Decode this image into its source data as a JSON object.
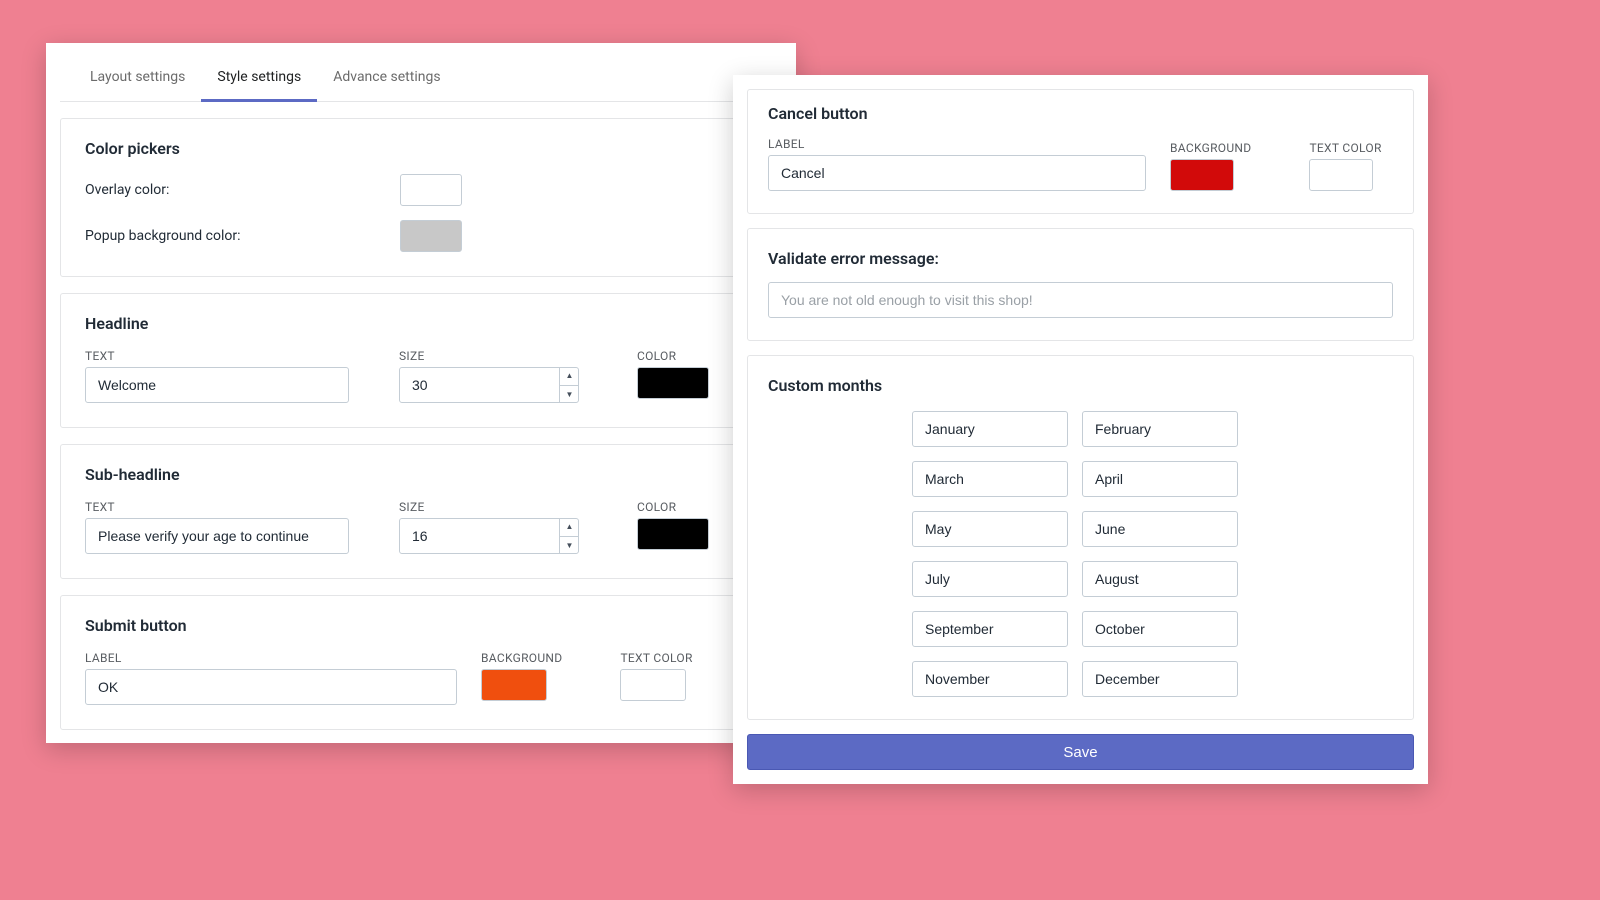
{
  "tabs": {
    "layout": "Layout settings",
    "style": "Style settings",
    "advance": "Advance settings"
  },
  "colorPickers": {
    "title": "Color pickers",
    "overlay": {
      "label": "Overlay color:",
      "value": "#ffffff"
    },
    "popupBg": {
      "label": "Popup background color:",
      "value": "#c8c8c8"
    }
  },
  "headline": {
    "title": "Headline",
    "textLabel": "TEXT",
    "textValue": "Welcome",
    "sizeLabel": "SIZE",
    "sizeValue": "30",
    "colorLabel": "COLOR",
    "colorValue": "#000000"
  },
  "subheadline": {
    "title": "Sub-headline",
    "textLabel": "TEXT",
    "textValue": "Please verify your age to continue",
    "sizeLabel": "SIZE",
    "sizeValue": "16",
    "colorLabel": "COLOR",
    "colorValue": "#000000"
  },
  "submitButton": {
    "title": "Submit button",
    "labelLabel": "LABEL",
    "labelValue": "OK",
    "bgLabel": "BACKGROUND",
    "bgValue": "#f04f0e",
    "tcLabel": "TEXT COLOR",
    "tcValue": "#ffffff"
  },
  "cancelButton": {
    "title": "Cancel button",
    "labelLabel": "LABEL",
    "labelValue": "Cancel",
    "bgLabel": "BACKGROUND",
    "bgValue": "#d20a0a",
    "tcLabel": "TEXT COLOR",
    "tcValue": "#ffffff"
  },
  "validateError": {
    "title": "Validate error message:",
    "placeholder": "You are not old enough to visit this shop!"
  },
  "customMonths": {
    "title": "Custom months",
    "months": [
      "January",
      "February",
      "March",
      "April",
      "May",
      "June",
      "July",
      "August",
      "September",
      "October",
      "November",
      "December"
    ]
  },
  "saveLabel": "Save"
}
